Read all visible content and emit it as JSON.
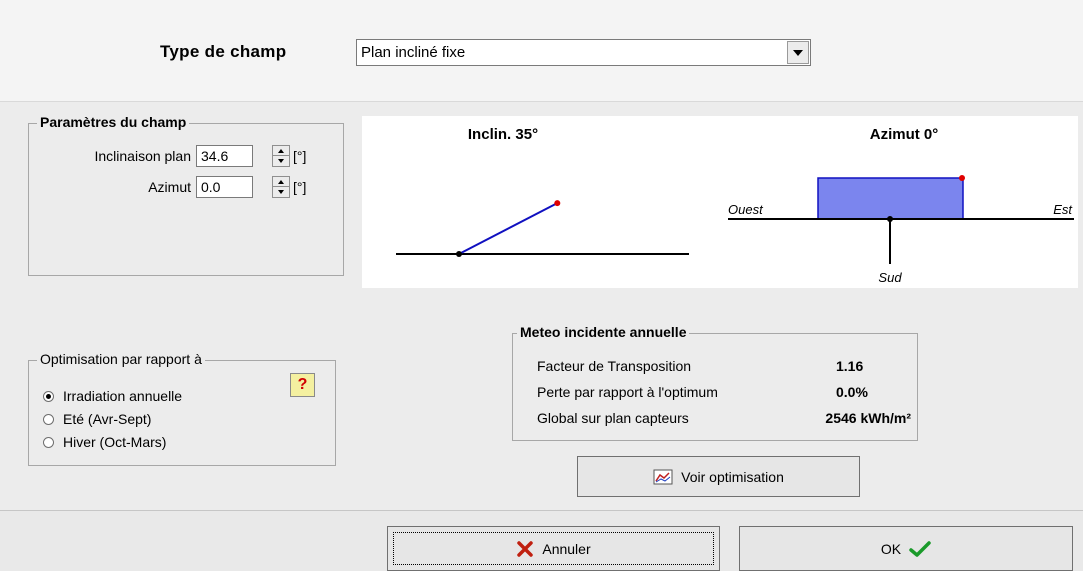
{
  "header": {
    "type_label": "Type de champ",
    "type_value": "Plan incliné fixe"
  },
  "params": {
    "title": "Paramètres du champ",
    "inclinaison_label": "Inclinaison plan",
    "inclinaison_value": "34.6",
    "azimut_label": "Azimut",
    "azimut_value": "0.0",
    "unit": "[°]"
  },
  "diagram": {
    "incline_title": "Inclin. 35°",
    "azimut_title": "Azimut 0°",
    "label_west": "Ouest",
    "label_east": "Est",
    "label_south": "Sud",
    "incline_angle_deg": 35,
    "azimut_deg": 0,
    "line_color": "#1010c0",
    "fill_color": "#7b85ee",
    "marker_color": "#e00000"
  },
  "optimisation": {
    "title": "Optimisation par rapport à",
    "help_label": "?",
    "options": [
      {
        "label": "Irradiation annuelle",
        "selected": true
      },
      {
        "label": "Eté (Avr-Sept)",
        "selected": false
      },
      {
        "label": "Hiver (Oct-Mars)",
        "selected": false
      }
    ]
  },
  "meteo": {
    "title": "Meteo incidente annuelle",
    "rows": [
      {
        "label": "Facteur de Transposition",
        "value": "1.16"
      },
      {
        "label": "Perte par rapport à l'optimum",
        "value": "0.0%"
      },
      {
        "label": "Global sur plan capteurs",
        "value": "2546 kWh/m²"
      }
    ]
  },
  "buttons": {
    "voir_optimisation": "Voir optimisation",
    "annuler": "Annuler",
    "ok": "OK"
  }
}
